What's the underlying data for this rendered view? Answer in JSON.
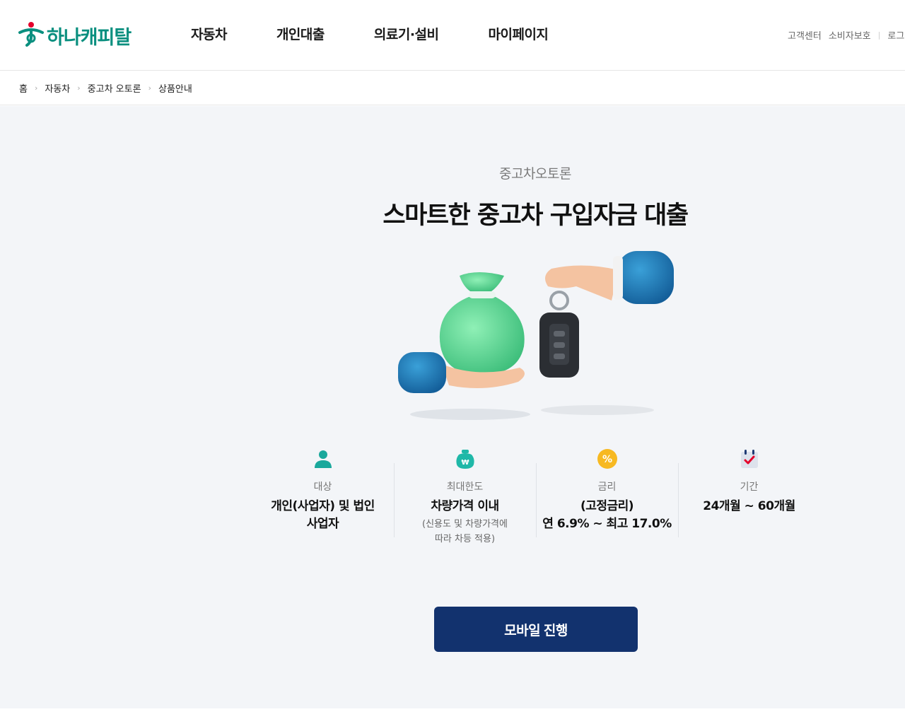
{
  "header": {
    "logo_text": "하나캐피탈",
    "nav": [
      "자동차",
      "개인대출",
      "의료기·설비",
      "마이페이지"
    ],
    "util": [
      "고객센터",
      "소비자보호",
      "로그인"
    ]
  },
  "breadcrumb": [
    "홈",
    "자동차",
    "중고차 오토론",
    "상품안내"
  ],
  "hero": {
    "subtitle": "중고차오토론",
    "title": "스마트한 중고차 구입자금 대출"
  },
  "info": [
    {
      "icon": "person-icon",
      "label": "대상",
      "value_lines": [
        "개인(사업자) 및 법인",
        "사업자"
      ],
      "note_lines": []
    },
    {
      "icon": "money-bag-icon",
      "label": "최대한도",
      "value_lines": [
        "차량가격 이내"
      ],
      "note_lines": [
        "(신용도 및 차량가격에",
        "따라 차등 적용)"
      ]
    },
    {
      "icon": "percent-icon",
      "label": "금리",
      "value_lines": [
        "(고정금리)",
        "연 6.9% ~ 최고 17.0%"
      ],
      "note_lines": []
    },
    {
      "icon": "calendar-check-icon",
      "label": "기간",
      "value_lines": [
        "24개월 ~ 60개월"
      ],
      "note_lines": []
    }
  ],
  "cta": {
    "label": "모바일 진행"
  },
  "colors": {
    "brand_green": "#0a8f7f",
    "brand_red": "#e4002b",
    "cta_navy": "#12326e",
    "background": "#f3f5f8"
  }
}
